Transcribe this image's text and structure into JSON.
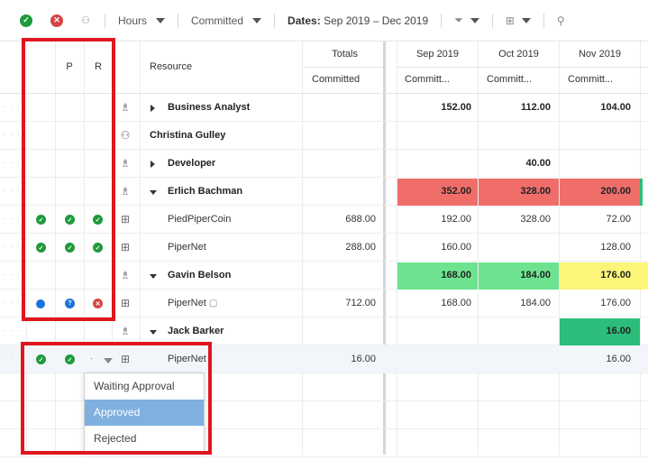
{
  "toolbar": {
    "hours_label": "Hours",
    "committed_label": "Committed",
    "dates_prefix": "Dates:",
    "dates_value": "Sep 2019 – Dec 2019"
  },
  "header": {
    "p_label": "P",
    "r_label": "R",
    "resource_label": "Resource",
    "totals_label": "Totals",
    "totals_sub": "Committed",
    "months": [
      {
        "label": "Sep 2019",
        "sub": "Committ..."
      },
      {
        "label": "Oct 2019",
        "sub": "Committ..."
      },
      {
        "label": "Nov 2019",
        "sub": "Committ..."
      }
    ]
  },
  "rows": [
    {
      "name": "Business Analyst",
      "sep": "152.00",
      "oct": "112.00",
      "nov": "104.00"
    },
    {
      "name": "Christina Gulley"
    },
    {
      "name": "Developer",
      "oct": "40.00"
    },
    {
      "name": "Erlich Bachman",
      "sep": "352.00",
      "oct": "328.00",
      "nov": "200.00"
    },
    {
      "name": "PiedPiperCoin",
      "total": "688.00",
      "sep": "192.00",
      "oct": "328.00",
      "nov": "72.00"
    },
    {
      "name": "PiperNet",
      "total": "288.00",
      "sep": "160.00",
      "nov": "128.00"
    },
    {
      "name": "Gavin Belson",
      "sep": "168.00",
      "oct": "184.00",
      "nov": "176.00"
    },
    {
      "name": "PiperNet",
      "total": "712.00",
      "sep": "168.00",
      "oct": "184.00",
      "nov": "176.00"
    },
    {
      "name": "Jack Barker",
      "nov": "16.00"
    },
    {
      "name": "PiperNet",
      "total": "16.00",
      "nov": "16.00"
    }
  ],
  "dropdown": {
    "options": [
      "Waiting Approval",
      "Approved",
      "Rejected"
    ],
    "selected": "Approved"
  },
  "colors": {
    "red": "#f06e6a",
    "green": "#6de38f",
    "yellow": "#fbf67a",
    "dark_green": "#2bbd79",
    "annotation": "#e0161e"
  }
}
